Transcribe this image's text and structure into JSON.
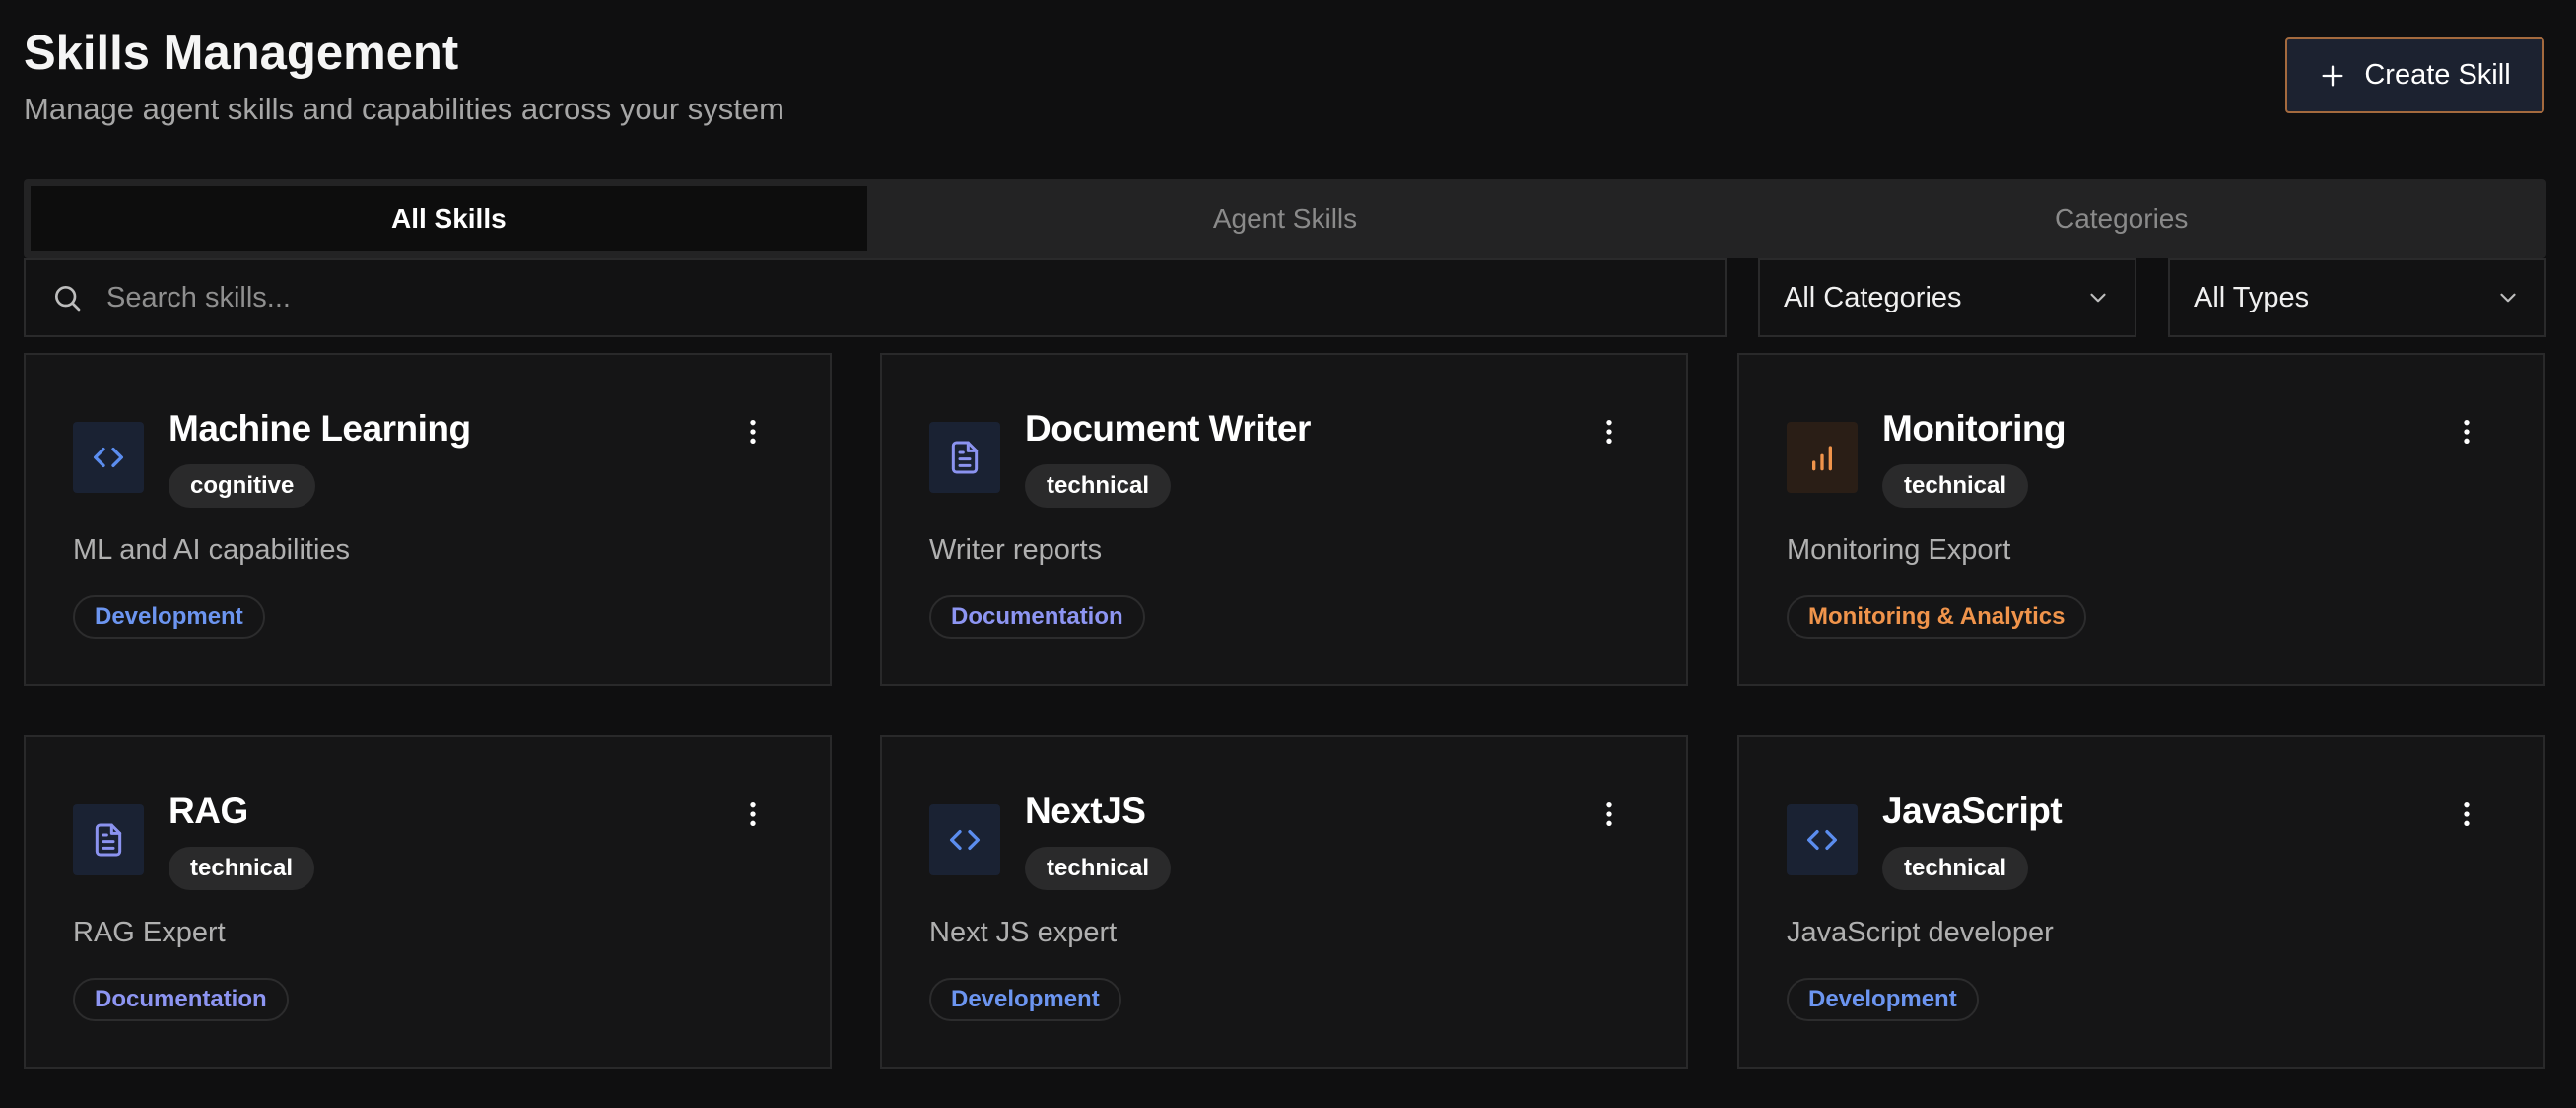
{
  "header": {
    "title": "Skills Management",
    "subtitle": "Manage agent skills and capabilities across your system",
    "create_button_label": "Create Skill"
  },
  "tabs": [
    {
      "label": "All Skills",
      "active": true
    },
    {
      "label": "Agent Skills",
      "active": false
    },
    {
      "label": "Categories",
      "active": false
    }
  ],
  "search": {
    "placeholder": "Search skills...",
    "value": ""
  },
  "filters": {
    "category": {
      "selected": "All Categories"
    },
    "type": {
      "selected": "All Types"
    }
  },
  "colors": {
    "accent_blue": "#5b8def",
    "accent_purple": "#8b93f0",
    "accent_orange": "#f0944b",
    "create_button_border": "#a46a3e"
  },
  "skills": [
    {
      "name": "Machine Learning",
      "type": "cognitive",
      "description": "ML and AI capabilities",
      "category": "Development",
      "icon": "code-icon",
      "category_color": "#6c95f0"
    },
    {
      "name": "Document Writer",
      "type": "technical",
      "description": "Writer reports",
      "category": "Documentation",
      "icon": "document-icon",
      "category_color": "#8d95f2"
    },
    {
      "name": "Monitoring",
      "type": "technical",
      "description": "Monitoring Export",
      "category": "Monitoring & Analytics",
      "icon": "bar-chart-icon",
      "category_color": "#f0944b"
    },
    {
      "name": "RAG",
      "type": "technical",
      "description": "RAG Expert",
      "category": "Documentation",
      "icon": "document-icon",
      "category_color": "#8d95f2"
    },
    {
      "name": "NextJS",
      "type": "technical",
      "description": "Next JS expert",
      "category": "Development",
      "icon": "code-icon",
      "category_color": "#6c95f0"
    },
    {
      "name": "JavaScript",
      "type": "technical",
      "description": "JavaScript developer",
      "category": "Development",
      "icon": "code-icon",
      "category_color": "#6c95f0"
    }
  ]
}
